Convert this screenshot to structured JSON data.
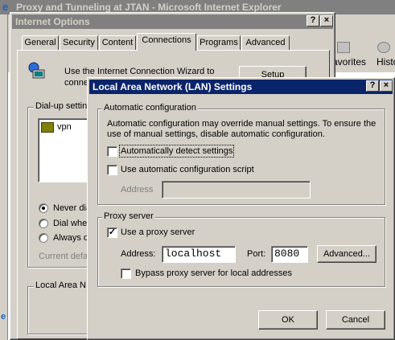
{
  "browser": {
    "title": "Proxy and Tunneling at JTAN - Microsoft Internet Explorer",
    "toolbar_favorites": "avorites",
    "toolbar_history": "Histo"
  },
  "internet_options": {
    "title": "Internet Options",
    "tabs": [
      "General",
      "Security",
      "Content",
      "Connections",
      "Programs",
      "Advanced"
    ],
    "wizard_text_1": "Use the Internet Connection Wizard to",
    "wizard_text_2": "conne",
    "setup_button": "Setup",
    "dialup_legend": "Dial-up settin",
    "dialup_item": "vpn",
    "radio_never": "Never dia",
    "radio_when": "Dial whe",
    "radio_always": "Always d",
    "current_default": "Current defau",
    "lan_legend": "Local Area N"
  },
  "lan_dialog": {
    "title": "Local Area Network (LAN) Settings",
    "help_glyph": "?",
    "close_glyph": "×",
    "auto_config": {
      "legend": "Automatic configuration",
      "description": "Automatic configuration may override manual settings.  To ensure the use of manual settings, disable automatic configuration.",
      "detect_label": "Automatically detect settings",
      "detect_checked": false,
      "script_label": "Use automatic configuration script",
      "script_checked": false,
      "address_label": "Address",
      "address_value": ""
    },
    "proxy": {
      "legend": "Proxy server",
      "use_proxy_label": "Use a proxy server",
      "use_proxy_checked": true,
      "address_label": "Address:",
      "address_value": "localhost",
      "port_label": "Port:",
      "port_value": "8080",
      "advanced_button": "Advanced...",
      "bypass_label": "Bypass proxy server for local addresses",
      "bypass_checked": false
    },
    "ok_button": "OK",
    "cancel_button": "Cancel"
  },
  "colors": {
    "title_active": "#0a246a",
    "title_inactive": "#808080",
    "face": "#d4d0c8"
  }
}
